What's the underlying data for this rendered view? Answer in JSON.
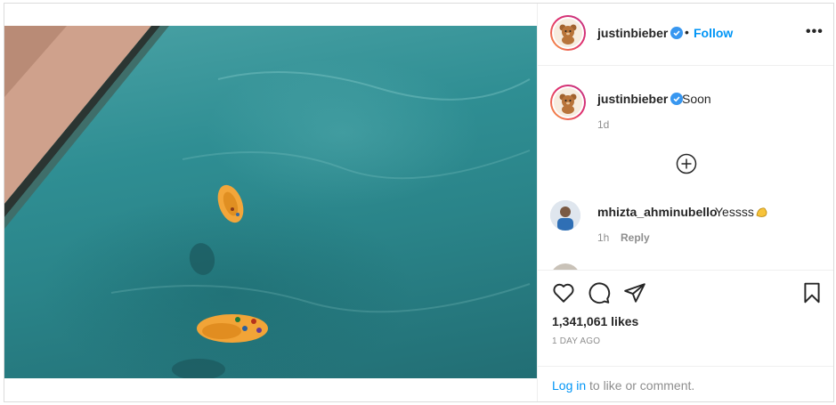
{
  "post": {
    "author": "justinbieber",
    "follow_label": "Follow",
    "dot": "•",
    "more_label": "•••",
    "caption": "Soon",
    "caption_time": "1d",
    "likes": "1,341,061 likes",
    "time": "1 DAY AGO"
  },
  "comments": [
    {
      "username": "mhizta_ahminubello",
      "text": "Yessss",
      "emoji": "flexed-biceps",
      "time": "1h",
      "reply_label": "Reply"
    },
    {
      "username": "…",
      "text": ""
    }
  ],
  "login": {
    "link": "Log in",
    "rest": "to like or comment."
  },
  "icons": {
    "verified": "verified-badge-icon",
    "load_more": "plus-circle-icon",
    "like": "heart-icon",
    "comment": "comment-icon",
    "share": "share-icon",
    "save": "bookmark-icon"
  },
  "colors": {
    "accent": "#0095f6",
    "verified": "#3897f0",
    "muted": "#8e8e8e",
    "text": "#262626",
    "border": "#dbdbdb"
  }
}
